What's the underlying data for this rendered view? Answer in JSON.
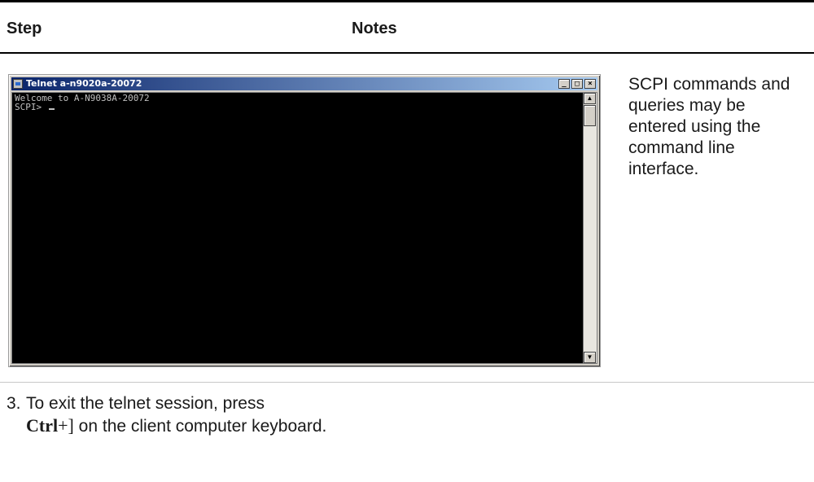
{
  "table": {
    "header_step": "Step",
    "header_notes": "Notes"
  },
  "telnet_window": {
    "title": "Telnet a-n9020a-20072",
    "line1": "Welcome to A-N9038A-20072",
    "prompt": "SCPI> ",
    "minimize_glyph": "_",
    "maximize_glyph": "□",
    "close_glyph": "×",
    "scroll_up_glyph": "▲",
    "scroll_down_glyph": "▼"
  },
  "note": {
    "text": "SCPI commands and queries may be entered using the command line interface."
  },
  "step3": {
    "number": "3.",
    "text_before": "To exit the telnet session, press",
    "key": "Ctrl",
    "key_rest": "+]",
    "text_after": "on the client computer keyboard."
  }
}
